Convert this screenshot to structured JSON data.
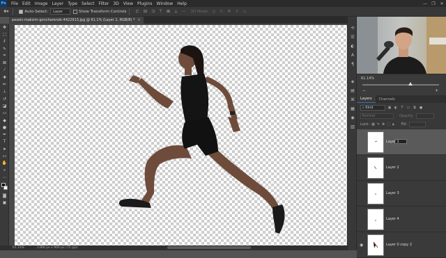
{
  "app": {
    "logo": "Ps"
  },
  "menu": [
    "File",
    "Edit",
    "Image",
    "Layer",
    "Type",
    "Select",
    "Filter",
    "3D",
    "View",
    "Plugins",
    "Window",
    "Help"
  ],
  "window_controls": [
    "—",
    "❐",
    "✕"
  ],
  "options_bar": {
    "auto_select_label": "Auto-Select:",
    "auto_select_value": "Layer",
    "show_transform_label": "Show Transform Controls",
    "mode_3d_label": "3D Mode:"
  },
  "document": {
    "tab_title": "pexels-maksim-goncharenok-4422913.jpg @ 61.1% (Layer 1, RGB/8) *",
    "close": "×"
  },
  "status": {
    "zoom": "61.14%",
    "size": "1366 px x 900 px (72 ppi)"
  },
  "properties": {
    "zoom_value": "61.14%",
    "minus": "−",
    "plus": "+",
    "zoom_fraction": 0.63
  },
  "panel_tabs": {
    "layers": "Layers",
    "channels": "Channels"
  },
  "layers_panel": {
    "kind_label": "Kind",
    "blend_mode": "Normal",
    "opacity_label": "Opacity:",
    "lock_label": "Lock:",
    "fill_label": "Fill:"
  },
  "layers": [
    {
      "name": "Layer 1",
      "selected": true,
      "visible": false
    },
    {
      "name": "Layer 2",
      "selected": false,
      "visible": false
    },
    {
      "name": "Layer 3",
      "selected": false,
      "visible": false
    },
    {
      "name": "Layer 4",
      "selected": false,
      "visible": false
    },
    {
      "name": "Layer 0 copy 2",
      "selected": false,
      "visible": true
    }
  ],
  "colors": {
    "accent": "#2f6fc3",
    "canvas_check": "#cdcdcd"
  }
}
